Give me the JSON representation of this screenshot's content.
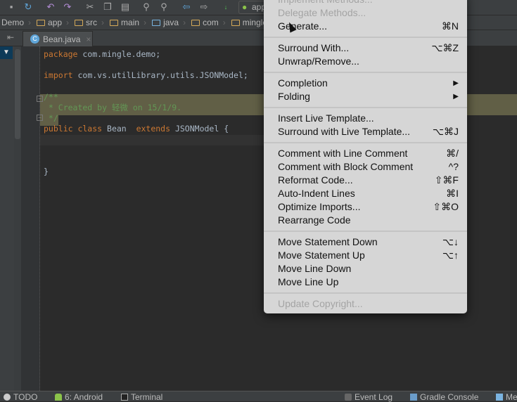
{
  "toolbar": {
    "run_config": "app"
  },
  "breadcrumb": [
    "Demo",
    "app",
    "src",
    "main",
    "java",
    "com",
    "mingle"
  ],
  "tab": {
    "label": "Bean.java",
    "close": "×",
    "icon": "C"
  },
  "code": {
    "l1_kw": "package",
    "l1_rest": " com.mingle.demo;",
    "l3_kw": "import",
    "l3_rest": " com.vs.utilLibrary.utils.JSONModel;",
    "l5": "/**",
    "l6": " * Created by 轻微 on 15/1/9.",
    "l7": " */",
    "l8_kw1": "public class",
    "l8_name": " Bean  ",
    "l8_kw2": "extends",
    "l8_rest": " JSONModel {",
    "l12": "}"
  },
  "menu": {
    "items": [
      {
        "label": "Implement Methods...",
        "shortcut": "",
        "disabled": true
      },
      {
        "label": "Delegate Methods...",
        "shortcut": "",
        "disabled": true
      },
      {
        "label": "Generate...",
        "shortcut": "⌘N"
      },
      {
        "sep": true
      },
      {
        "label": "Surround With...",
        "shortcut": "⌥⌘Z"
      },
      {
        "label": "Unwrap/Remove...",
        "shortcut": ""
      },
      {
        "sep": true
      },
      {
        "label": "Completion",
        "shortcut": "▶"
      },
      {
        "label": "Folding",
        "shortcut": "▶"
      },
      {
        "sep": true
      },
      {
        "label": "Insert Live Template...",
        "shortcut": ""
      },
      {
        "label": "Surround with Live Template...",
        "shortcut": "⌥⌘J"
      },
      {
        "sep": true
      },
      {
        "label": "Comment with Line Comment",
        "shortcut": "⌘/"
      },
      {
        "label": "Comment with Block Comment",
        "shortcut": "^?"
      },
      {
        "label": "Reformat Code...",
        "shortcut": "⇧⌘F"
      },
      {
        "label": "Auto-Indent Lines",
        "shortcut": "⌘I"
      },
      {
        "label": "Optimize Imports...",
        "shortcut": "⇧⌘O"
      },
      {
        "label": "Rearrange Code",
        "shortcut": ""
      },
      {
        "sep": true
      },
      {
        "label": "Move Statement Down",
        "shortcut": "⌥↓"
      },
      {
        "label": "Move Statement Up",
        "shortcut": "⌥↑"
      },
      {
        "label": "Move Line Down",
        "shortcut": ""
      },
      {
        "label": "Move Line Up",
        "shortcut": ""
      },
      {
        "sep": true
      },
      {
        "label": "Update Copyright...",
        "shortcut": "",
        "disabled": true
      }
    ]
  },
  "status": {
    "todo": "TODO",
    "android": "6: Android",
    "terminal": "Terminal",
    "event_log": "Event Log",
    "gradle": "Gradle Console",
    "more": "Me"
  }
}
